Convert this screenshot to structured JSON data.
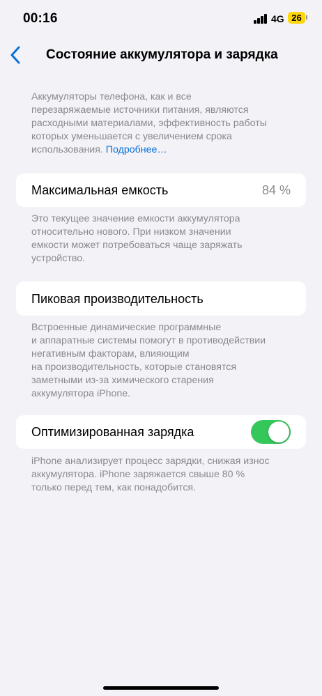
{
  "status_bar": {
    "time": "00:16",
    "network": "4G",
    "battery_level": "26"
  },
  "nav": {
    "title": "Состояние аккумулятора и зарядка"
  },
  "intro": {
    "lines": [
      "Аккумуляторы телефона, как и все",
      "перезаряжаемые источники питания, являются",
      "расходными материалами, эффективность работы",
      "которых уменьшается с увеличением срока",
      "использования."
    ],
    "link": "Подробнее…"
  },
  "max_capacity": {
    "label": "Максимальная емкость",
    "value": "84 %",
    "footnote_lines": [
      "Это текущее значение емкости аккумулятора",
      "относительно нового. При низком значении",
      "емкости может потребоваться чаще заряжать",
      "устройство."
    ]
  },
  "peak_performance": {
    "label": "Пиковая производительность",
    "footnote_lines": [
      "Встроенные динамические программные",
      "и аппаратные системы помогут в противодействии",
      "негативным факторам, влияющим",
      "на производительность, которые становятся",
      "заметными из-за химического старения",
      "аккумулятора iPhone."
    ]
  },
  "optimized_charging": {
    "label": "Оптимизированная зарядка",
    "enabled": true,
    "footnote_lines": [
      "iPhone анализирует процесс зарядки, снижая износ",
      "аккумулятора. iPhone заряжается свыше 80 %",
      "только перед тем, как понадобится."
    ]
  },
  "colors": {
    "background": "#f2f2f7",
    "link": "#0a6fd8",
    "toggle_on": "#34c759",
    "battery": "#ffd60a"
  },
  "icons": {
    "back": "chevron-left-icon",
    "signal": "cellular-signal-icon",
    "battery": "battery-icon"
  }
}
